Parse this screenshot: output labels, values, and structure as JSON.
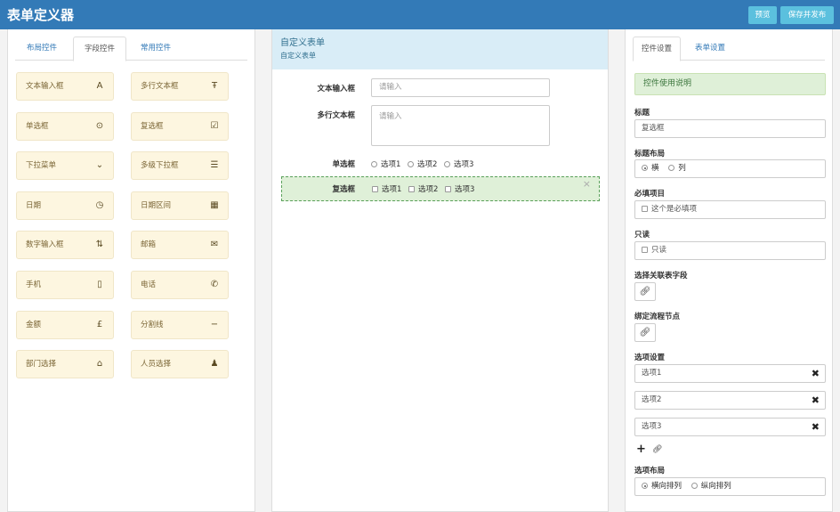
{
  "header": {
    "title": "表单定义器",
    "preview": "预览",
    "save_publish": "保存并发布"
  },
  "left": {
    "tabs": [
      "布局控件",
      "字段控件",
      "常用控件"
    ],
    "items": [
      {
        "label": "文本输入框",
        "icon": "text-a-icon",
        "glyph": "A"
      },
      {
        "label": "多行文本框",
        "icon": "text-height-icon",
        "glyph": "Ŧ"
      },
      {
        "label": "单选框",
        "icon": "radio-icon",
        "glyph": "⊙"
      },
      {
        "label": "复选框",
        "icon": "checkbox-icon",
        "glyph": "☑"
      },
      {
        "label": "下拉菜单",
        "icon": "chevron-down-icon",
        "glyph": "⌄"
      },
      {
        "label": "多级下拉框",
        "icon": "list-icon",
        "glyph": "☰"
      },
      {
        "label": "日期",
        "icon": "clock-icon",
        "glyph": "◷"
      },
      {
        "label": "日期区间",
        "icon": "calendar-icon",
        "glyph": "▦"
      },
      {
        "label": "数字输入框",
        "icon": "sort-number-icon",
        "glyph": "⇅"
      },
      {
        "label": "邮箱",
        "icon": "envelope-icon",
        "glyph": "✉"
      },
      {
        "label": "手机",
        "icon": "mobile-icon",
        "glyph": "▯"
      },
      {
        "label": "电话",
        "icon": "phone-icon",
        "glyph": "✆"
      },
      {
        "label": "金额",
        "icon": "pound-icon",
        "glyph": "£"
      },
      {
        "label": "分割线",
        "icon": "minus-icon",
        "glyph": "−"
      },
      {
        "label": "部门选择",
        "icon": "home-icon",
        "glyph": "⌂"
      },
      {
        "label": "人员选择",
        "icon": "user-icon",
        "glyph": "♟"
      }
    ]
  },
  "form": {
    "title": "自定义表单",
    "subtitle": "自定义表单",
    "fields": {
      "text": {
        "label": "文本输入框",
        "placeholder": "请输入"
      },
      "textarea": {
        "label": "多行文本框",
        "placeholder": "请输入"
      },
      "radio": {
        "label": "单选框",
        "options": [
          "选项1",
          "选项2",
          "选项3"
        ]
      },
      "checkbox": {
        "label": "复选框",
        "options": [
          "选项1",
          "选项2",
          "选项3"
        ],
        "close": "×"
      }
    }
  },
  "props": {
    "tabs": [
      "控件设置",
      "表单设置"
    ],
    "help": "控件使用说明",
    "title_label": "标题",
    "title_value": "复选框",
    "title_layout_label": "标题布局",
    "title_layout_options": [
      "横",
      "列"
    ],
    "required_label": "必填项目",
    "required_text": "这个是必填项",
    "readonly_label": "只读",
    "readonly_text": "只读",
    "link_field_label": "选择关联表字段",
    "bind_node_label": "绑定流程节点",
    "options_label": "选项设置",
    "options": [
      "选项1",
      "选项2",
      "选项3"
    ],
    "options_layout_label": "选项布局",
    "options_layout_values": [
      "横向排列",
      "纵向排列"
    ]
  },
  "colors": {
    "header": "#337ab7",
    "button": "#5bc0de",
    "item_bg": "#fdf6e0",
    "form_head": "#d9edf7",
    "selected": "#dff0d8",
    "help": "#dff0d8"
  }
}
